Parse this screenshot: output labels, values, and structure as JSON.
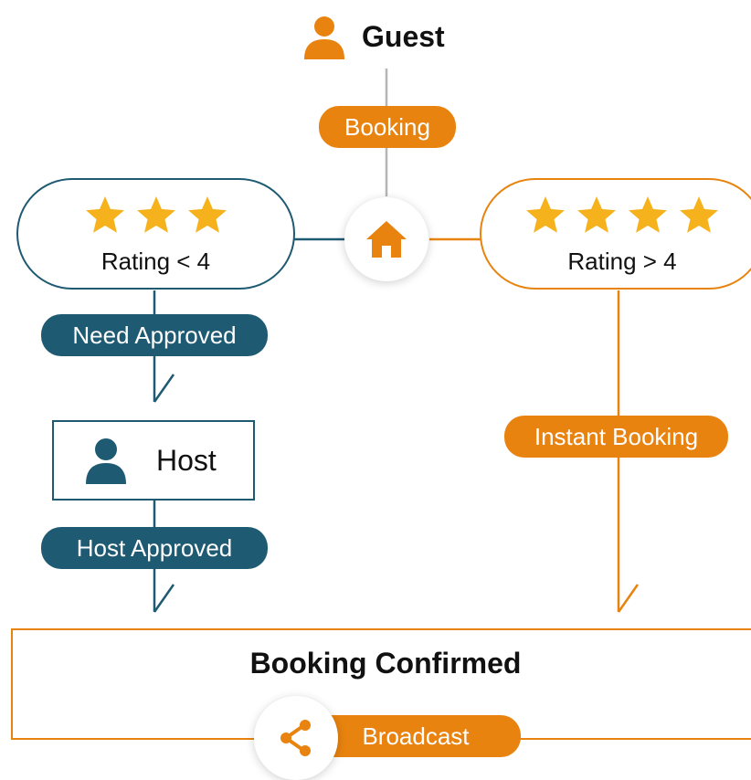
{
  "guest": {
    "label": "Guest",
    "icon": "user-icon"
  },
  "booking_label": "Booking",
  "home_icon": "home-icon",
  "low_rating": {
    "label": "Rating < 4",
    "stars": 3,
    "icon": "star-icon"
  },
  "high_rating": {
    "label": "Rating > 4",
    "stars": 4,
    "icon": "star-icon"
  },
  "need_approved_label": "Need Approved",
  "host": {
    "label": "Host",
    "icon": "user-icon"
  },
  "host_approved_label": "Host Approved",
  "instant_booking_label": "Instant Booking",
  "confirmed_title": "Booking Confirmed",
  "broadcast": {
    "label": "Broadcast",
    "icon": "share-icon"
  },
  "colors": {
    "orange": "#e8830f",
    "blue": "#1f5a73",
    "gray": "#b5b5b5",
    "star": "#f5b21c"
  }
}
